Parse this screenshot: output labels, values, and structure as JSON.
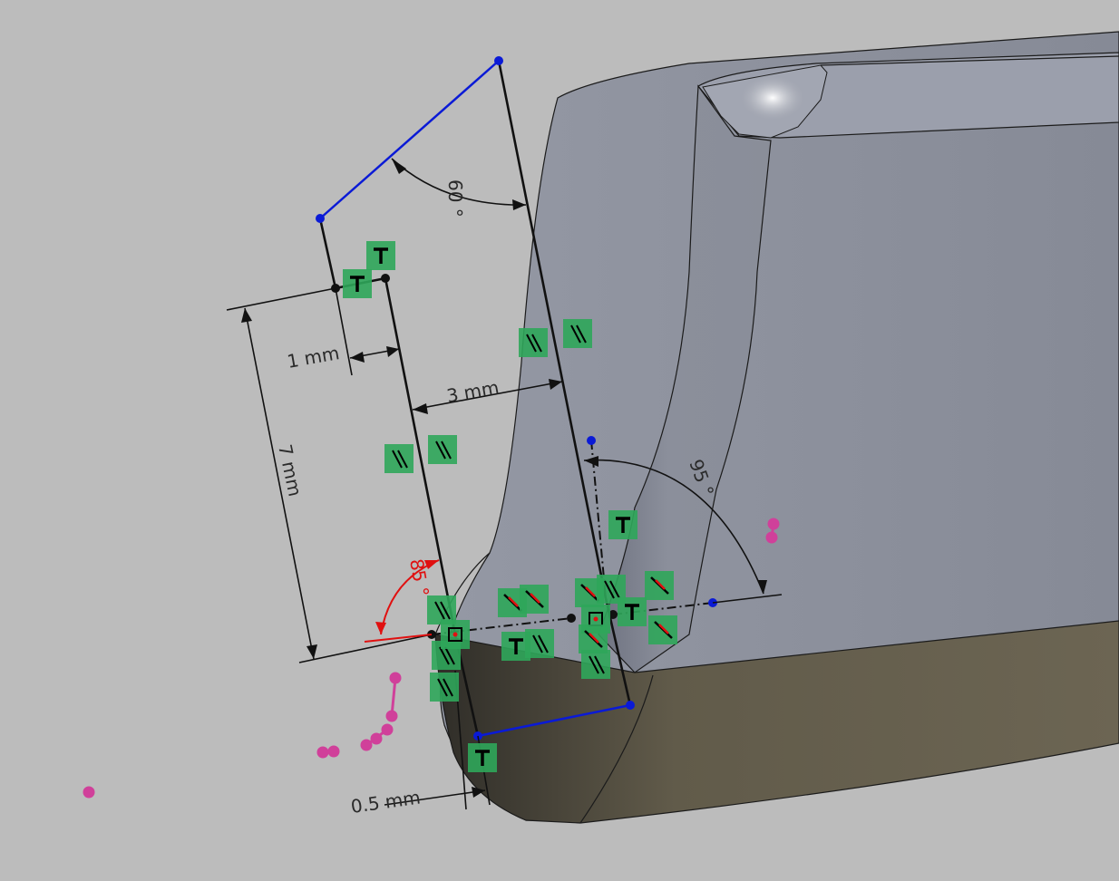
{
  "app": {
    "view": "3D sketch viewport"
  },
  "dimensions": {
    "angle_top": "60 °",
    "angle_right": "95 °",
    "angle_left": "85 °",
    "width_1": "1 mm",
    "width_3": "3 mm",
    "height_7": "7 mm",
    "offset_05": "0.5 mm"
  },
  "constraint_icons": {
    "parallel": "parallel-constraint-icon",
    "perpendicular": "perpendicular-constraint-icon",
    "coincident": "coincident-constraint-icon",
    "tangent": "tangent-constraint-icon"
  },
  "colors": {
    "background": "#bcbcbc",
    "part_face": "#8a8e9a",
    "part_bottom": "#6b6452",
    "sketch_line": "#111111",
    "construction_blue": "#0a1ad6",
    "constraint_green": "#2fa65a",
    "angle_red": "#e01010",
    "magenta_points": "#d0409a"
  }
}
